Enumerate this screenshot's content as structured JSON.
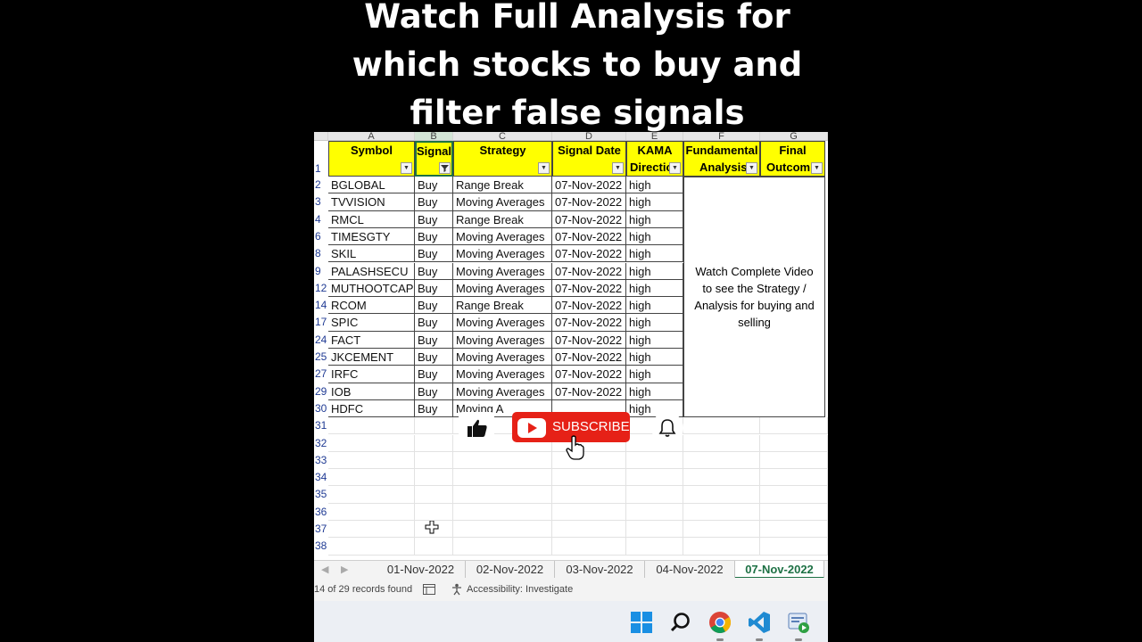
{
  "caption": {
    "line1": "Watch Full Analysis for",
    "line2": "which stocks to buy and",
    "line3": "filter false signals"
  },
  "sheet": {
    "column_letters": [
      "A",
      "B",
      "C",
      "D",
      "E",
      "F",
      "G"
    ],
    "headers": {
      "symbol": "Symbol",
      "signal": "Signal",
      "strategy": "Strategy",
      "signal_date": "Signal Date",
      "kama_line1": "KAMA",
      "kama_line2": "Directic",
      "fund_line1": "Fundamental",
      "fund_line2": "Analysis",
      "final_line1": "Final",
      "final_line2": "Outcom"
    },
    "header_row_num": "1",
    "rows": [
      {
        "num": "2",
        "symbol": "BGLOBAL",
        "signal": "Buy",
        "strategy": "Range Break",
        "date": "07-Nov-2022",
        "kama": "high"
      },
      {
        "num": "3",
        "symbol": "TVVISION",
        "signal": "Buy",
        "strategy": "Moving Averages",
        "date": "07-Nov-2022",
        "kama": "high"
      },
      {
        "num": "4",
        "symbol": "RMCL",
        "signal": "Buy",
        "strategy": "Range Break",
        "date": "07-Nov-2022",
        "kama": "high"
      },
      {
        "num": "6",
        "symbol": "TIMESGTY",
        "signal": "Buy",
        "strategy": "Moving Averages",
        "date": "07-Nov-2022",
        "kama": "high"
      },
      {
        "num": "8",
        "symbol": "SKIL",
        "signal": "Buy",
        "strategy": "Moving Averages",
        "date": "07-Nov-2022",
        "kama": "high"
      },
      {
        "num": "9",
        "symbol": "PALASHSECU",
        "signal": "Buy",
        "strategy": "Moving Averages",
        "date": "07-Nov-2022",
        "kama": "high"
      },
      {
        "num": "12",
        "symbol": "MUTHOOTCAP",
        "signal": "Buy",
        "strategy": "Moving Averages",
        "date": "07-Nov-2022",
        "kama": "high"
      },
      {
        "num": "14",
        "symbol": "RCOM",
        "signal": "Buy",
        "strategy": "Range Break",
        "date": "07-Nov-2022",
        "kama": "high"
      },
      {
        "num": "17",
        "symbol": "SPIC",
        "signal": "Buy",
        "strategy": "Moving Averages",
        "date": "07-Nov-2022",
        "kama": "high"
      },
      {
        "num": "24",
        "symbol": "FACT",
        "signal": "Buy",
        "strategy": "Moving Averages",
        "date": "07-Nov-2022",
        "kama": "high"
      },
      {
        "num": "25",
        "symbol": "JKCEMENT",
        "signal": "Buy",
        "strategy": "Moving Averages",
        "date": "07-Nov-2022",
        "kama": "high"
      },
      {
        "num": "27",
        "symbol": "IRFC",
        "signal": "Buy",
        "strategy": "Moving Averages",
        "date": "07-Nov-2022",
        "kama": "high"
      },
      {
        "num": "29",
        "symbol": "IOB",
        "signal": "Buy",
        "strategy": "Moving Averages",
        "date": "07-Nov-2022",
        "kama": "high"
      },
      {
        "num": "30",
        "symbol": "HDFC",
        "signal": "Buy",
        "strategy": "Moving A",
        "date": "",
        "kama": "high"
      }
    ],
    "empty_rows": [
      "31",
      "32",
      "33",
      "34",
      "35",
      "36",
      "37",
      "38"
    ],
    "merged_note": "Watch Complete Video to see the Strategy / Analysis for buying and selling"
  },
  "subscribe": {
    "label": "SUBSCRIBE"
  },
  "tabs": [
    "01-Nov-2022",
    "02-Nov-2022",
    "03-Nov-2022",
    "04-Nov-2022",
    "07-Nov-2022"
  ],
  "active_tab": "07-Nov-2022",
  "status": {
    "records": "14 of 29 records found",
    "accessibility": "Accessibility: Investigate"
  },
  "colors": {
    "header_yellow": "#ffff00",
    "subscribe_red": "#e62117",
    "active_tab_green": "#1e7145"
  },
  "icons": [
    "thumbs-up-icon",
    "youtube-play-icon",
    "hand-cursor-icon",
    "bell-icon",
    "windows-start-icon",
    "search-icon",
    "chrome-icon",
    "vscode-icon",
    "app-icon",
    "crosshair-cursor-icon",
    "filter-icon",
    "macro-icon"
  ]
}
